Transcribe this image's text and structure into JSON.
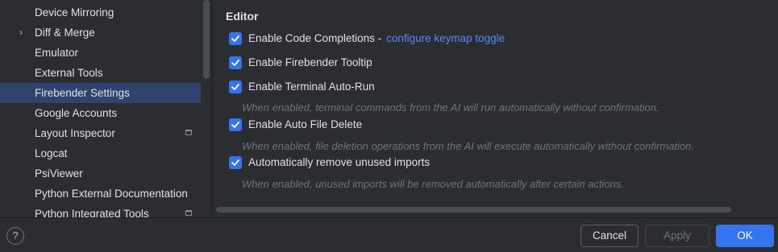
{
  "sidebar": {
    "items": [
      {
        "label": "Device Mirroring"
      },
      {
        "label": "Diff & Merge",
        "expander": "›"
      },
      {
        "label": "Emulator"
      },
      {
        "label": "External Tools"
      },
      {
        "label": "Firebender Settings"
      },
      {
        "label": "Google Accounts"
      },
      {
        "label": "Layout Inspector"
      },
      {
        "label": "Logcat"
      },
      {
        "label": "PsiViewer"
      },
      {
        "label": "Python External Documentation"
      },
      {
        "label": "Python Integrated Tools"
      }
    ],
    "selected": "Firebender Settings"
  },
  "editor": {
    "title": "Editor",
    "options": [
      {
        "label": "Enable Code Completions -",
        "link": "configure keymap toggle",
        "checked": true
      },
      {
        "label": "Enable Firebender Tooltip",
        "checked": true
      },
      {
        "label": "Enable Terminal Auto-Run",
        "hint": "When enabled, terminal commands from the AI will run automatically without confirmation.",
        "checked": true
      },
      {
        "label": "Enable Auto File Delete",
        "hint": "When enabled, file deletion operations from the AI will execute automatically without confirmation.",
        "checked": true
      },
      {
        "label": "Automatically remove unused imports",
        "hint": "When enabled, unused imports will be removed automatically after certain actions.",
        "checked": true
      }
    ]
  },
  "footer": {
    "help": "?",
    "cancel": "Cancel",
    "apply": "Apply",
    "ok": "OK"
  },
  "colors": {
    "background": "#2b2d30",
    "accent": "#3574f0",
    "link": "#548af7",
    "selection": "#2e436e",
    "hint": "#6f737a"
  }
}
